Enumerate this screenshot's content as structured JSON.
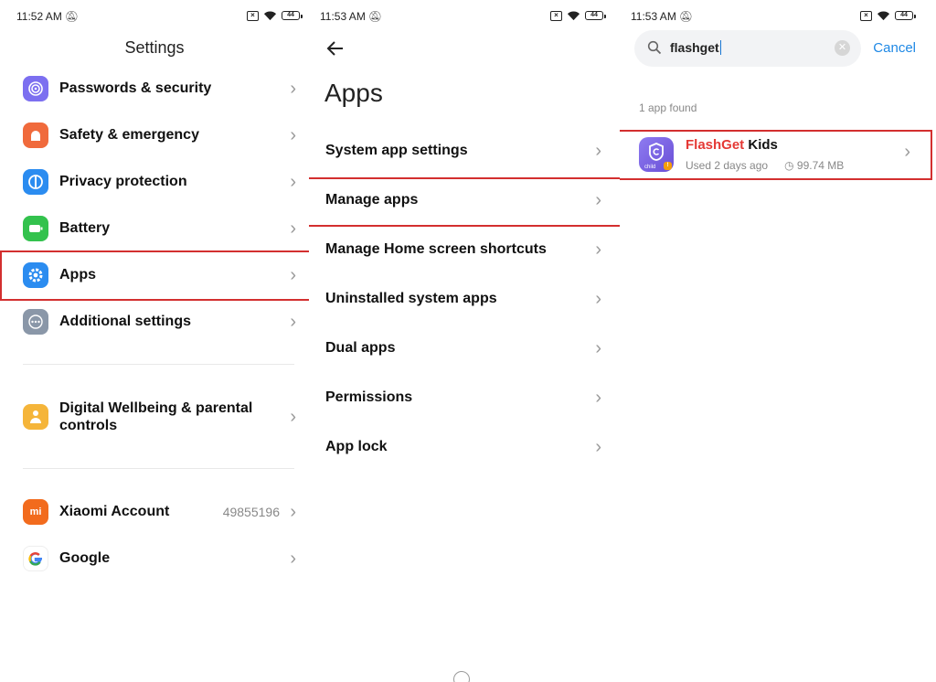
{
  "status": [
    {
      "time": "11:52 AM",
      "battery": "44"
    },
    {
      "time": "11:53 AM",
      "battery": "44"
    },
    {
      "time": "11:53 AM",
      "battery": "44"
    }
  ],
  "settings": {
    "title": "Settings",
    "items": [
      {
        "label": "Passwords & security",
        "icon": "fingerprint-icon",
        "color": "#7c6ff0"
      },
      {
        "label": "Safety & emergency",
        "icon": "emergency-icon",
        "color": "#f06a3c"
      },
      {
        "label": "Privacy protection",
        "icon": "privacy-icon",
        "color": "#2b8cf0"
      },
      {
        "label": "Battery",
        "icon": "battery-icon",
        "color": "#33c24d"
      },
      {
        "label": "Apps",
        "icon": "gear-icon",
        "color": "#2b8cf0"
      },
      {
        "label": "Additional settings",
        "icon": "more-icon",
        "color": "#8a97a8"
      },
      {
        "label": "Digital Wellbeing & parental controls",
        "icon": "wellbeing-icon",
        "color": "#f5b53a"
      },
      {
        "label": "Xiaomi Account",
        "icon": "mi-icon",
        "color": "#f26b1d",
        "value": "49855196"
      },
      {
        "label": "Google",
        "icon": "google-icon",
        "color": "#ffffff"
      }
    ]
  },
  "apps": {
    "title": "Apps",
    "items": [
      {
        "label": "System app settings"
      },
      {
        "label": "Manage apps"
      },
      {
        "label": "Manage Home screen shortcuts"
      },
      {
        "label": "Uninstalled system apps"
      },
      {
        "label": "Dual apps"
      },
      {
        "label": "Permissions"
      },
      {
        "label": "App lock"
      }
    ]
  },
  "search": {
    "query": "flashget",
    "cancel_label": "Cancel",
    "found_text": "1 app found",
    "result": {
      "name_match": "FlashGet",
      "name_rest": " Kids",
      "used": "Used 2 days ago",
      "size": "99.74 MB",
      "icon_label": "child"
    }
  },
  "highlight_color": "#d32f2f"
}
